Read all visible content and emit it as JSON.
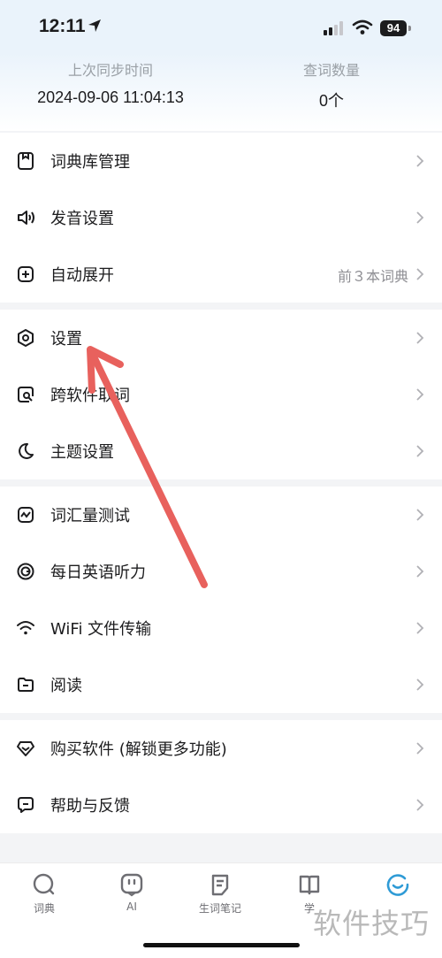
{
  "status_bar": {
    "time": "12:11",
    "battery": "94"
  },
  "sync": {
    "last_sync_label": "上次同步时间",
    "last_sync_value": "2024-09-06 11:04:13",
    "lookup_count_label": "查词数量",
    "lookup_count_value": "0个"
  },
  "menu_groups": [
    {
      "items": [
        {
          "icon": "dictionary-icon",
          "label": "词典库管理"
        },
        {
          "icon": "speaker-icon",
          "label": "发音设置"
        },
        {
          "icon": "plus-square-icon",
          "label": "自动展开",
          "value": "前３本词典"
        }
      ]
    },
    {
      "items": [
        {
          "icon": "hexagon-settings-icon",
          "label": "设置"
        },
        {
          "icon": "search-copy-icon",
          "label": "跨软件取词"
        },
        {
          "icon": "moon-icon",
          "label": "主题设置"
        }
      ]
    },
    {
      "items": [
        {
          "icon": "chart-icon",
          "label": "词汇量测试"
        },
        {
          "icon": "headphones-icon",
          "label": "每日英语听力"
        },
        {
          "icon": "wifi-icon",
          "label": "WiFi 文件传输"
        },
        {
          "icon": "folder-icon",
          "label": "阅读"
        }
      ]
    },
    {
      "items": [
        {
          "icon": "diamond-icon",
          "label": "购买软件 (解锁更多功能)"
        },
        {
          "icon": "feedback-icon",
          "label": "帮助与反馈"
        }
      ]
    }
  ],
  "tabbar": {
    "tabs": [
      {
        "label": "词典",
        "icon": "search-icon",
        "active": false
      },
      {
        "label": "AI",
        "icon": "ai-icon",
        "active": false
      },
      {
        "label": "生词笔记",
        "icon": "notebook-icon",
        "active": false
      },
      {
        "label": "学",
        "icon": "book-icon",
        "active": false
      },
      {
        "label": "",
        "icon": "smile-icon",
        "active": true
      }
    ]
  },
  "watermark": "软件技巧",
  "colors": {
    "accent": "#2f9bd6",
    "annotation_arrow": "#e8615d",
    "text": "#1c1c1e",
    "secondary_text": "#8e8e93"
  }
}
